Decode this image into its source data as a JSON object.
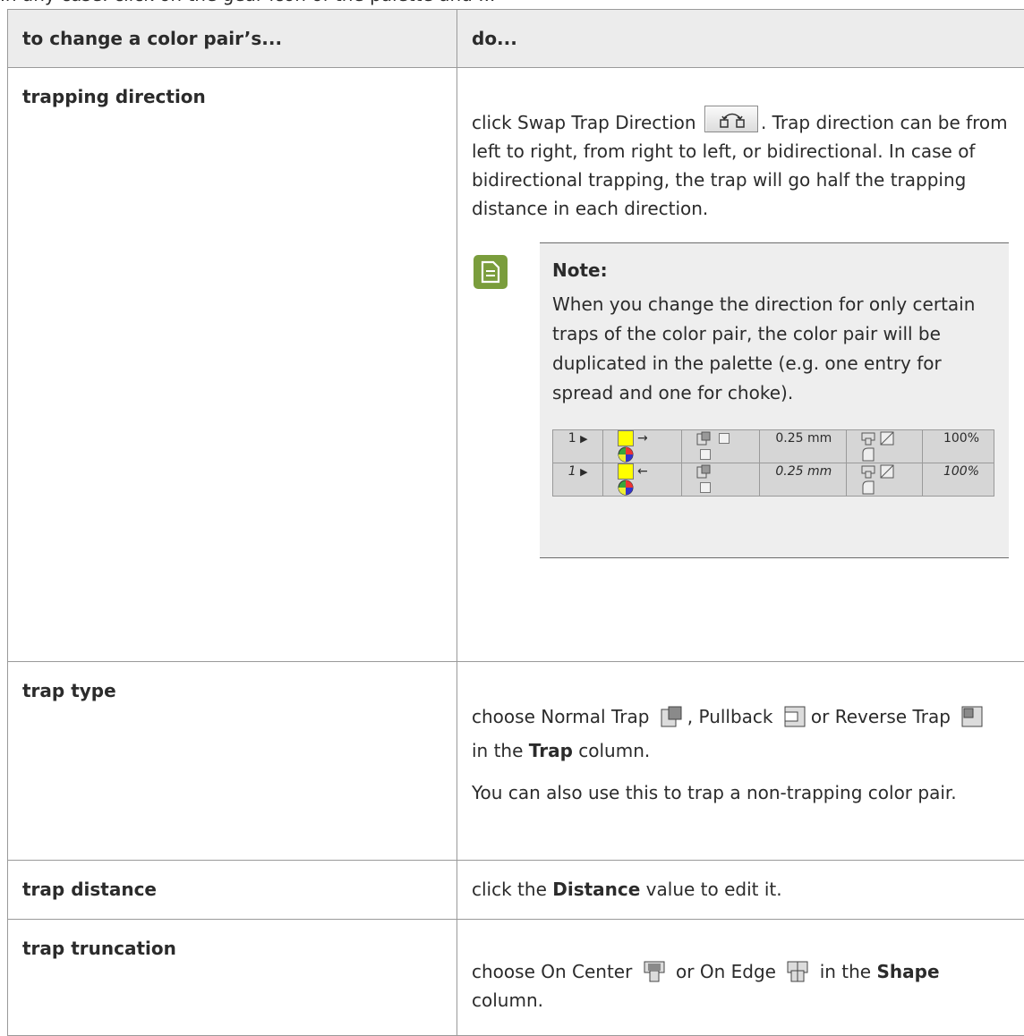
{
  "cut_line": "In any case: click on the gear icon of the palette and ...",
  "table": {
    "header": {
      "col1": "to change a color pair’s...",
      "col2": "do..."
    },
    "rows": {
      "direction": {
        "label": "trapping direction",
        "text_before": "click Swap Trap Direction",
        "text_after": ". Trap direction can be from left to right, from right to left, or bidirectional. In case of bidirectional trapping, the trap will go half the trapping distance in each direction.",
        "note_title": "Note:",
        "note_text": "When you change the direction for only certain traps of the color pair, the color pair will be duplicated in the palette (e.g. one entry for spread and one for choke).",
        "palette": [
          {
            "num": "1",
            "arrow": "→",
            "distance": "0.25 mm",
            "percent": "100%"
          },
          {
            "num": "1",
            "arrow": "←",
            "distance": "0.25 mm",
            "percent": "100%"
          }
        ]
      },
      "type": {
        "label": "trap type",
        "t1": "choose Normal Trap",
        "t2": ", Pullback",
        "t3": "or Reverse Trap",
        "t4": "in the",
        "t4_bold": "Trap",
        "t4_end": "column.",
        "p2": "You can also use this to trap a non-trapping color pair."
      },
      "distance": {
        "label": "trap distance",
        "t1": "click the",
        "t1_bold": "Distance",
        "t1_end": "value to edit it."
      },
      "truncation": {
        "label": "trap truncation",
        "t1": "choose On Center",
        "t2": "or On Edge",
        "t3": "in the",
        "t3_bold": "Shape",
        "t3_end": "column."
      }
    }
  },
  "colors": {
    "note_icon": "#7a9d3c",
    "swatch_yellow": "#ffff00",
    "header_bg": "#ececec"
  }
}
